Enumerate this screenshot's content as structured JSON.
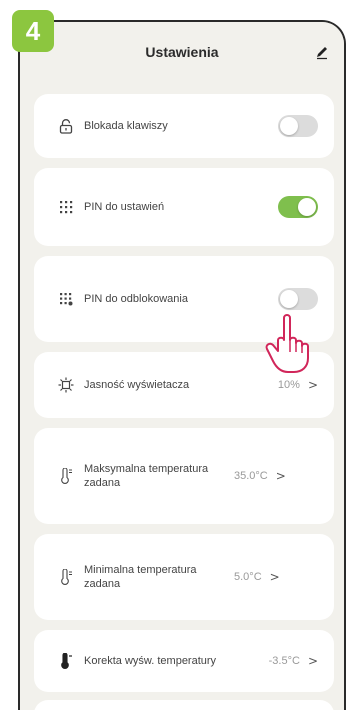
{
  "step_badge": "4",
  "header": {
    "title": "Ustawienia",
    "edit_icon": "pencil-icon"
  },
  "settings": [
    {
      "id": "keypad-lock",
      "icon": "lock-icon",
      "label": "Blokada klawiszy",
      "control": "toggle",
      "toggle_on": false
    },
    {
      "id": "settings-pin",
      "icon": "keypad-grid-icon",
      "label": "PIN do ustawień",
      "control": "toggle",
      "toggle_on": true
    },
    {
      "id": "unlock-pin",
      "icon": "keypad-dot-icon",
      "label": "PIN do odblokowania",
      "control": "toggle",
      "toggle_on": false
    },
    {
      "id": "brightness",
      "icon": "brightness-icon",
      "label": "Jasność wyświetacza",
      "value": "10%"
    },
    {
      "id": "max-temp",
      "icon": "thermometer-up-icon",
      "label": "Maksymalna temperatura zadana",
      "value": "35.0°C"
    },
    {
      "id": "min-temp",
      "icon": "thermometer-down-icon",
      "label": "Minimalna temperatura zadana",
      "value": "5.0°C"
    },
    {
      "id": "temp-correction",
      "icon": "thermometer-correction-icon",
      "label": "Korekta wyśw. temperatury",
      "value": "-3.5°C"
    }
  ],
  "chevron": ">",
  "colors": {
    "accent_green": "#8cc63f",
    "toggle_on": "#7fbf4d",
    "toggle_off": "#dcdcdc",
    "background": "#f2f1ec"
  },
  "pointer_icon": "hand-pointer-icon"
}
